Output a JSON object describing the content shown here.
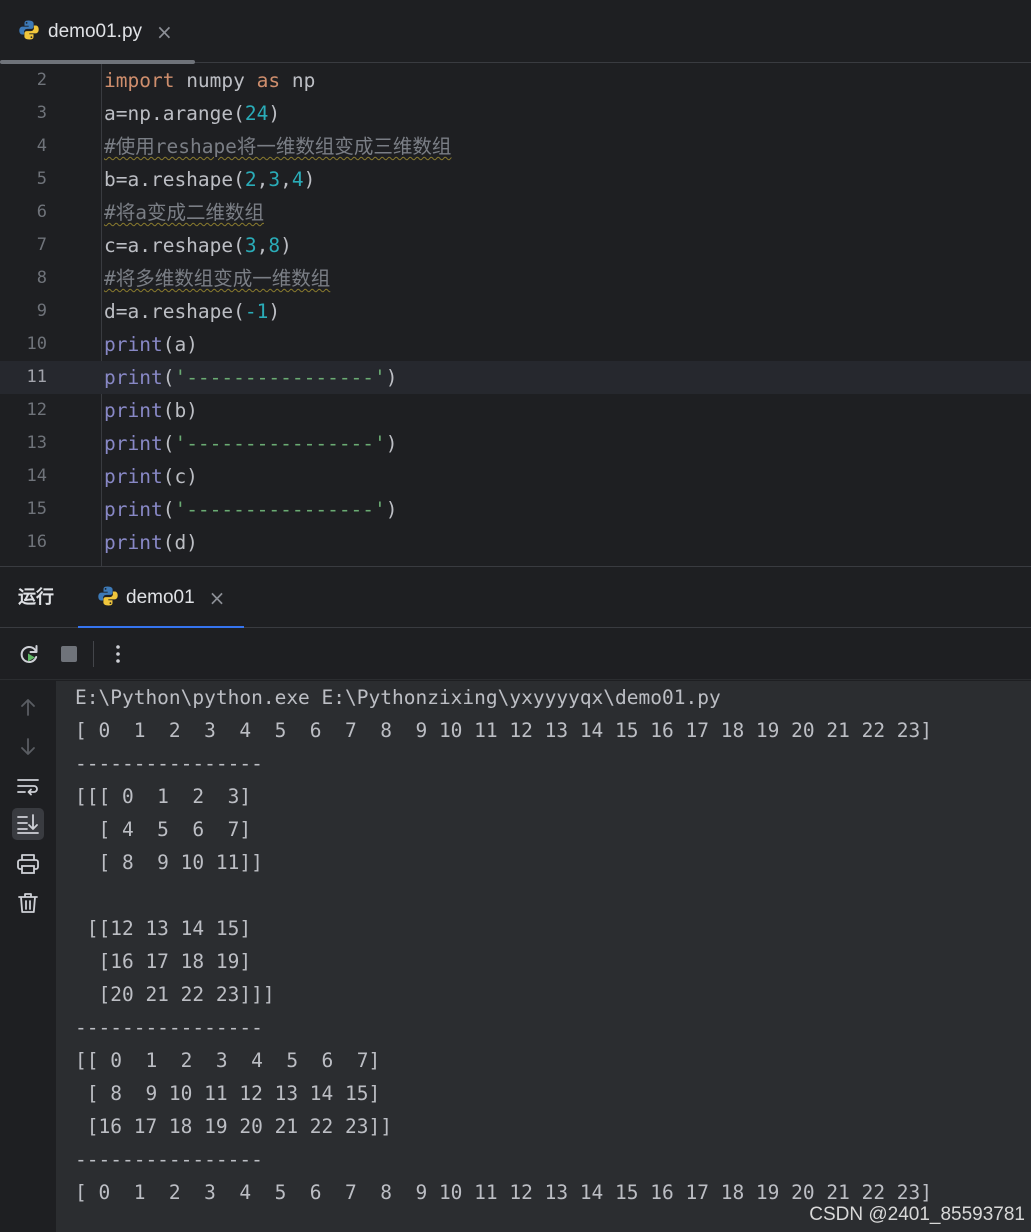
{
  "editor_tab": {
    "filename": "demo01.py",
    "close": "×"
  },
  "editor": {
    "lines": [
      {
        "n": "2",
        "t": "import numpy as np"
      },
      {
        "n": "3",
        "t": "a=np.arange(24)"
      },
      {
        "n": "4",
        "t": "#使用reshape将一维数组变成三维数组"
      },
      {
        "n": "5",
        "t": "b=a.reshape(2,3,4)"
      },
      {
        "n": "6",
        "t": "#将a变成二维数组"
      },
      {
        "n": "7",
        "t": "c=a.reshape(3,8)"
      },
      {
        "n": "8",
        "t": "#将多维数组变成一维数组"
      },
      {
        "n": "9",
        "t": "d=a.reshape(-1)"
      },
      {
        "n": "10",
        "t": "print(a)"
      },
      {
        "n": "11",
        "t": "print('----------------')"
      },
      {
        "n": "12",
        "t": "print(b)"
      },
      {
        "n": "13",
        "t": "print('----------------')"
      },
      {
        "n": "14",
        "t": "print(c)"
      },
      {
        "n": "15",
        "t": "print('----------------')"
      },
      {
        "n": "16",
        "t": "print(d)"
      }
    ],
    "current_line": "11"
  },
  "run_panel": {
    "title": "运行",
    "tab_label": "demo01",
    "close": "×",
    "toolbar_icons": [
      "rerun-icon",
      "stop-icon",
      "more-options-icon"
    ],
    "side_icons": [
      "scroll-up-icon",
      "scroll-down-icon",
      "soft-wrap-icon",
      "scroll-to-end-icon",
      "print-icon",
      "clear-icon"
    ]
  },
  "console": {
    "lines": [
      "E:\\Python\\python.exe E:\\Pythonzixing\\yxyyyyqx\\demo01.py",
      "[ 0  1  2  3  4  5  6  7  8  9 10 11 12 13 14 15 16 17 18 19 20 21 22 23]",
      "----------------",
      "[[[ 0  1  2  3]",
      "  [ 4  5  6  7]",
      "  [ 8  9 10 11]]",
      "",
      " [[12 13 14 15]",
      "  [16 17 18 19]",
      "  [20 21 22 23]]]",
      "----------------",
      "[[ 0  1  2  3  4  5  6  7]",
      " [ 8  9 10 11 12 13 14 15]",
      " [16 17 18 19 20 21 22 23]]",
      "----------------",
      "[ 0  1  2  3  4  5  6  7  8  9 10 11 12 13 14 15 16 17 18 19 20 21 22 23]"
    ]
  },
  "watermark": "CSDN @2401_85593781",
  "colors": {
    "background": "#1e1f22",
    "console_bg": "#2b2d30",
    "keyword": "#cf8e6d",
    "number": "#2aacb8",
    "builtin": "#8888c6",
    "string": "#6aab73",
    "comment": "#7a7e85",
    "accent": "#3574f0"
  }
}
